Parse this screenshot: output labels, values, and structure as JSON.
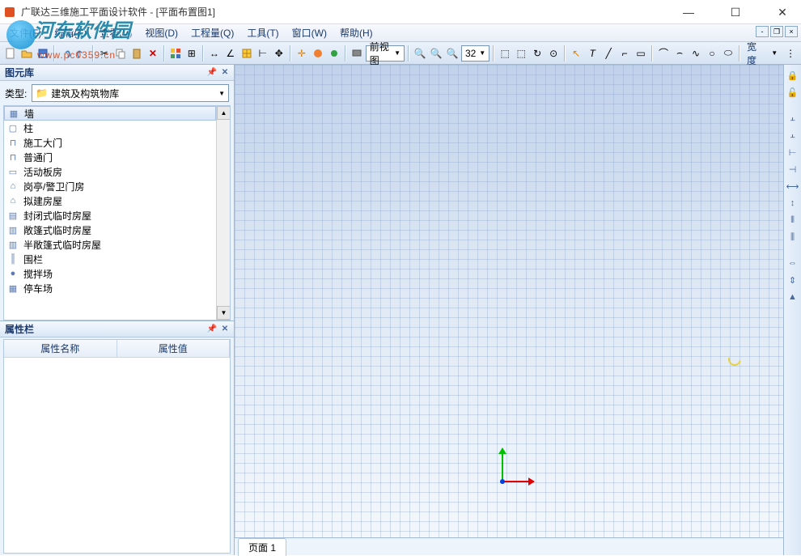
{
  "window": {
    "title": "广联达三维施工平面设计软件 - [平面布置图1]"
  },
  "watermark": {
    "text": "河东软件园",
    "url": "www.pc0359.cn"
  },
  "menu": {
    "file": "文件(F)",
    "edit": "编辑(E)",
    "view": "查看(V)",
    "view2": "视图(D)",
    "qty": "工程量(Q)",
    "tool": "工具(T)",
    "window": "窗口(W)",
    "help": "帮助(H)"
  },
  "toolbar": {
    "view_sel": "前视图",
    "zoom_val": "32",
    "width_label": "宽度"
  },
  "panel": {
    "lib_title": "图元库",
    "type_label": "类型:",
    "type_value": "建筑及构筑物库",
    "items": [
      "墙",
      "柱",
      "施工大门",
      "普通门",
      "活动板房",
      "岗亭/警卫门房",
      "拟建房屋",
      "封闭式临时房屋",
      "敞篷式临时房屋",
      "半敞篷式临时房屋",
      "围栏",
      "搅拌场",
      "停车场"
    ],
    "prop_title": "属性栏",
    "col_name": "属性名称",
    "col_val": "属性值"
  },
  "page": {
    "tab": "页面 1"
  }
}
